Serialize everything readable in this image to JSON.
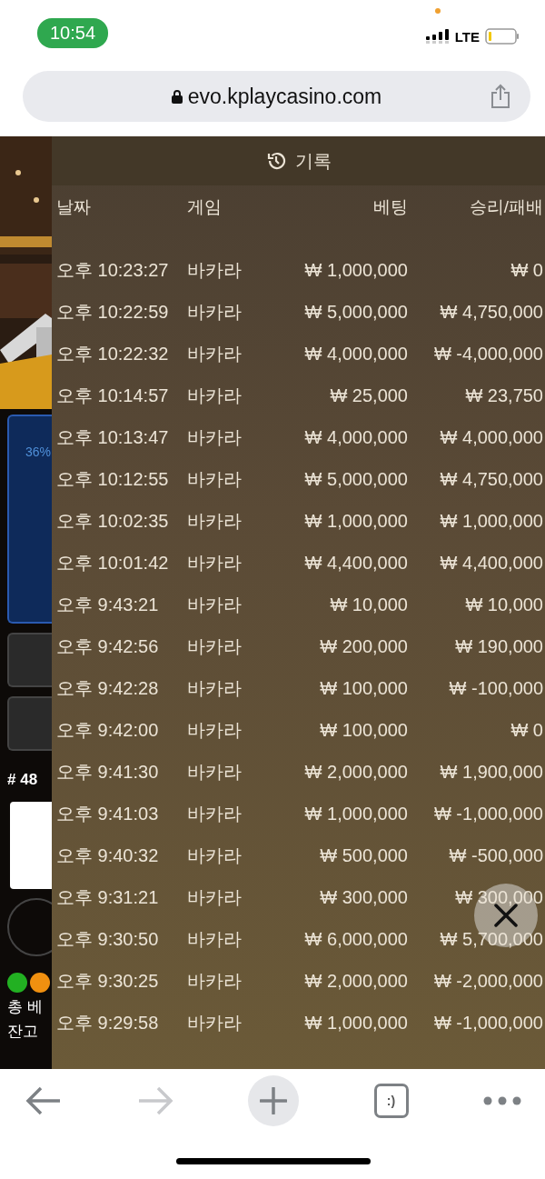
{
  "status_bar": {
    "time": "10:54",
    "network": "LTE"
  },
  "address_bar": {
    "url": "evo.kplaycasino.com"
  },
  "game": {
    "progress": "36%",
    "round": "# 48",
    "total_bet_label": "총 베",
    "balance_label": "잔고"
  },
  "history": {
    "title": "기록",
    "columns": [
      "날짜",
      "게임",
      "베팅",
      "승리/패배"
    ],
    "rows": [
      {
        "time": "오후 10:23:27",
        "game": "바카라",
        "bet": "₩ 1,000,000",
        "result": "₩ 0"
      },
      {
        "time": "오후 10:22:59",
        "game": "바카라",
        "bet": "₩ 5,000,000",
        "result": "₩ 4,750,000"
      },
      {
        "time": "오후 10:22:32",
        "game": "바카라",
        "bet": "₩ 4,000,000",
        "result": "₩ -4,000,000"
      },
      {
        "time": "오후 10:14:57",
        "game": "바카라",
        "bet": "₩ 25,000",
        "result": "₩ 23,750"
      },
      {
        "time": "오후 10:13:47",
        "game": "바카라",
        "bet": "₩ 4,000,000",
        "result": "₩ 4,000,000"
      },
      {
        "time": "오후 10:12:55",
        "game": "바카라",
        "bet": "₩ 5,000,000",
        "result": "₩ 4,750,000"
      },
      {
        "time": "오후 10:02:35",
        "game": "바카라",
        "bet": "₩ 1,000,000",
        "result": "₩ 1,000,000"
      },
      {
        "time": "오후 10:01:42",
        "game": "바카라",
        "bet": "₩ 4,400,000",
        "result": "₩ 4,400,000"
      },
      {
        "time": "오후 9:43:21",
        "game": "바카라",
        "bet": "₩ 10,000",
        "result": "₩ 10,000"
      },
      {
        "time": "오후 9:42:56",
        "game": "바카라",
        "bet": "₩ 200,000",
        "result": "₩ 190,000"
      },
      {
        "time": "오후 9:42:28",
        "game": "바카라",
        "bet": "₩ 100,000",
        "result": "₩ -100,000"
      },
      {
        "time": "오후 9:42:00",
        "game": "바카라",
        "bet": "₩ 100,000",
        "result": "₩ 0"
      },
      {
        "time": "오후 9:41:30",
        "game": "바카라",
        "bet": "₩ 2,000,000",
        "result": "₩ 1,900,000"
      },
      {
        "time": "오후 9:41:03",
        "game": "바카라",
        "bet": "₩ 1,000,000",
        "result": "₩ -1,000,000"
      },
      {
        "time": "오후 9:40:32",
        "game": "바카라",
        "bet": "₩ 500,000",
        "result": "₩ -500,000"
      },
      {
        "time": "오후 9:31:21",
        "game": "바카라",
        "bet": "₩ 300,000",
        "result": "₩ 300,000"
      },
      {
        "time": "오후 9:30:50",
        "game": "바카라",
        "bet": "₩ 6,000,000",
        "result": "₩ 5,700,000"
      },
      {
        "time": "오후 9:30:25",
        "game": "바카라",
        "bet": "₩ 2,000,000",
        "result": "₩ -2,000,000"
      },
      {
        "time": "오후 9:29:58",
        "game": "바카라",
        "bet": "₩ 1,000,000",
        "result": "₩ -1,000,000"
      }
    ]
  },
  "toolbar": {
    "forward_disabled": true,
    "tabs_label": ":)"
  }
}
